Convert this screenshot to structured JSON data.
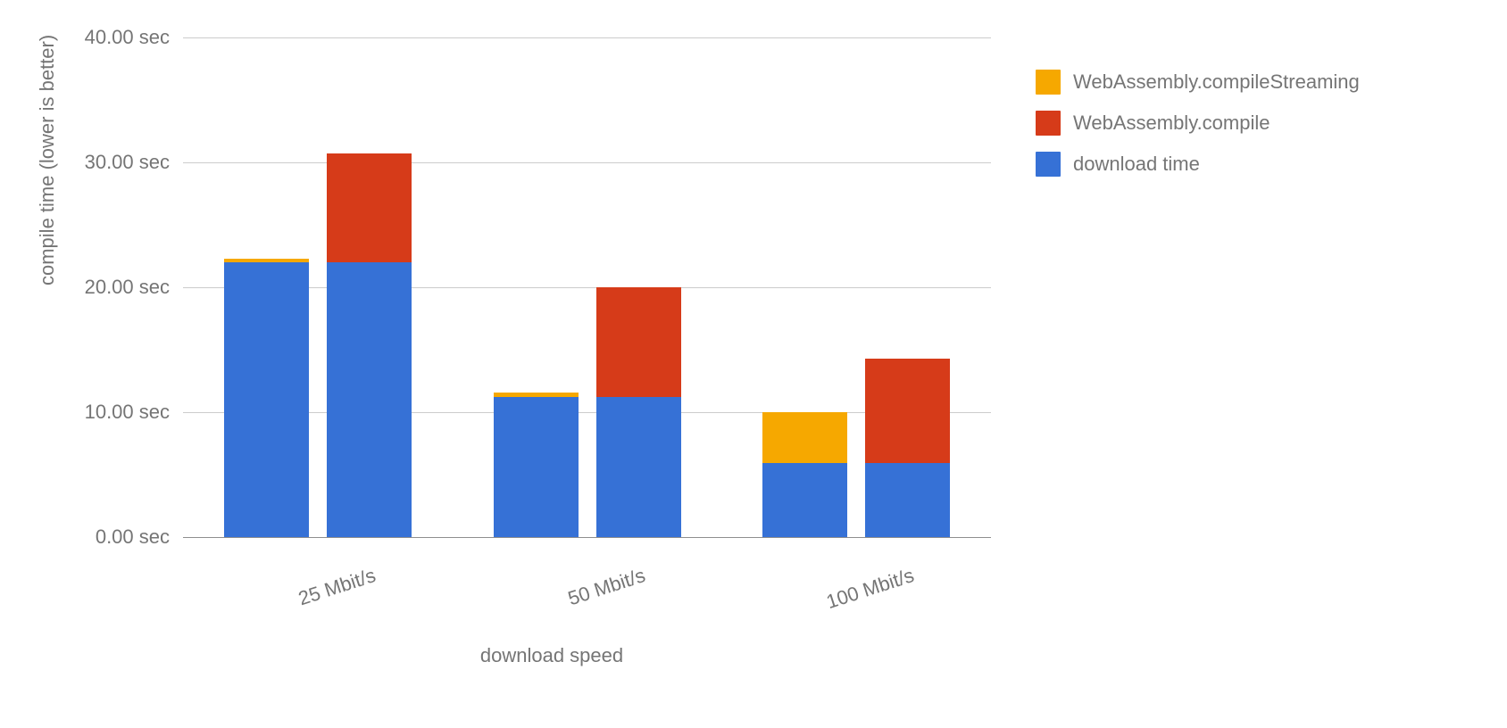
{
  "chart_data": {
    "type": "bar",
    "stacked": true,
    "grouped": true,
    "title": "",
    "xlabel": "download speed",
    "ylabel": "compile time (lower is better)",
    "ylim": [
      0,
      40
    ],
    "y_ticks": [
      0,
      10,
      20,
      30,
      40
    ],
    "y_tick_labels": [
      "0.00 sec",
      "10.00 sec",
      "20.00 sec",
      "30.00 sec",
      "40.00 sec"
    ],
    "categories": [
      "25 Mbit/s",
      "50 Mbit/s",
      "100 Mbit/s"
    ],
    "series": [
      {
        "name": "WebAssembly.compileStreaming",
        "color": "#f6a800"
      },
      {
        "name": "WebAssembly.compile",
        "color": "#d63b19"
      },
      {
        "name": "download time",
        "color": "#3671d6"
      }
    ],
    "groups": [
      {
        "category": "25 Mbit/s",
        "bars": [
          {
            "label": "streaming",
            "stacks": {
              "download time": 22.0,
              "WebAssembly.compileStreaming": 0.3
            }
          },
          {
            "label": "compile",
            "stacks": {
              "download time": 22.0,
              "WebAssembly.compile": 8.7
            }
          }
        ]
      },
      {
        "category": "50 Mbit/s",
        "bars": [
          {
            "label": "streaming",
            "stacks": {
              "download time": 11.2,
              "WebAssembly.compileStreaming": 0.4
            }
          },
          {
            "label": "compile",
            "stacks": {
              "download time": 11.2,
              "WebAssembly.compile": 8.8
            }
          }
        ]
      },
      {
        "category": "100 Mbit/s",
        "bars": [
          {
            "label": "streaming",
            "stacks": {
              "download time": 5.9,
              "WebAssembly.compileStreaming": 4.1
            }
          },
          {
            "label": "compile",
            "stacks": {
              "download time": 5.9,
              "WebAssembly.compile": 8.4
            }
          }
        ]
      }
    ]
  },
  "legend": {
    "items": [
      {
        "name": "WebAssembly.compileStreaming",
        "color": "#f6a800"
      },
      {
        "name": "WebAssembly.compile",
        "color": "#d63b19"
      },
      {
        "name": "download time",
        "color": "#3671d6"
      }
    ]
  }
}
